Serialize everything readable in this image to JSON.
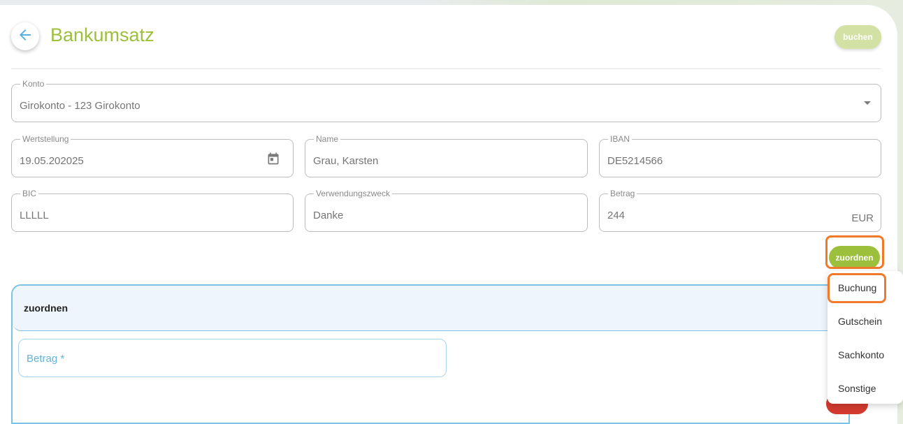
{
  "header": {
    "title": "Bankumsatz",
    "buchen_label": "buchen"
  },
  "form": {
    "konto": {
      "label": "Konto",
      "value": "Girokonto - 123 Girokonto"
    },
    "wertstellung": {
      "label": "Wertstellung",
      "value": "19.05.202025"
    },
    "name": {
      "label": "Name",
      "value": "Grau, Karsten"
    },
    "iban": {
      "label": "IBAN",
      "value": "DE5214566"
    },
    "bic": {
      "label": "BIC",
      "value": "LLLLL"
    },
    "verwendungszweck": {
      "label": "Verwendungszweck",
      "value": "Danke"
    },
    "betrag": {
      "label": "Betrag",
      "value": "244",
      "currency": "EUR"
    }
  },
  "zuordnen_button": "zuordnen",
  "panel": {
    "title": "zuordnen",
    "betrag_placeholder": "Betrag *"
  },
  "menu": {
    "items": [
      "Buchung",
      "Gutschein",
      "Sachkonto",
      "Sonstige"
    ]
  },
  "colors": {
    "accent": "#9cbf3c",
    "highlight": "#f07a2a",
    "panel_border": "#7cc3e3"
  }
}
